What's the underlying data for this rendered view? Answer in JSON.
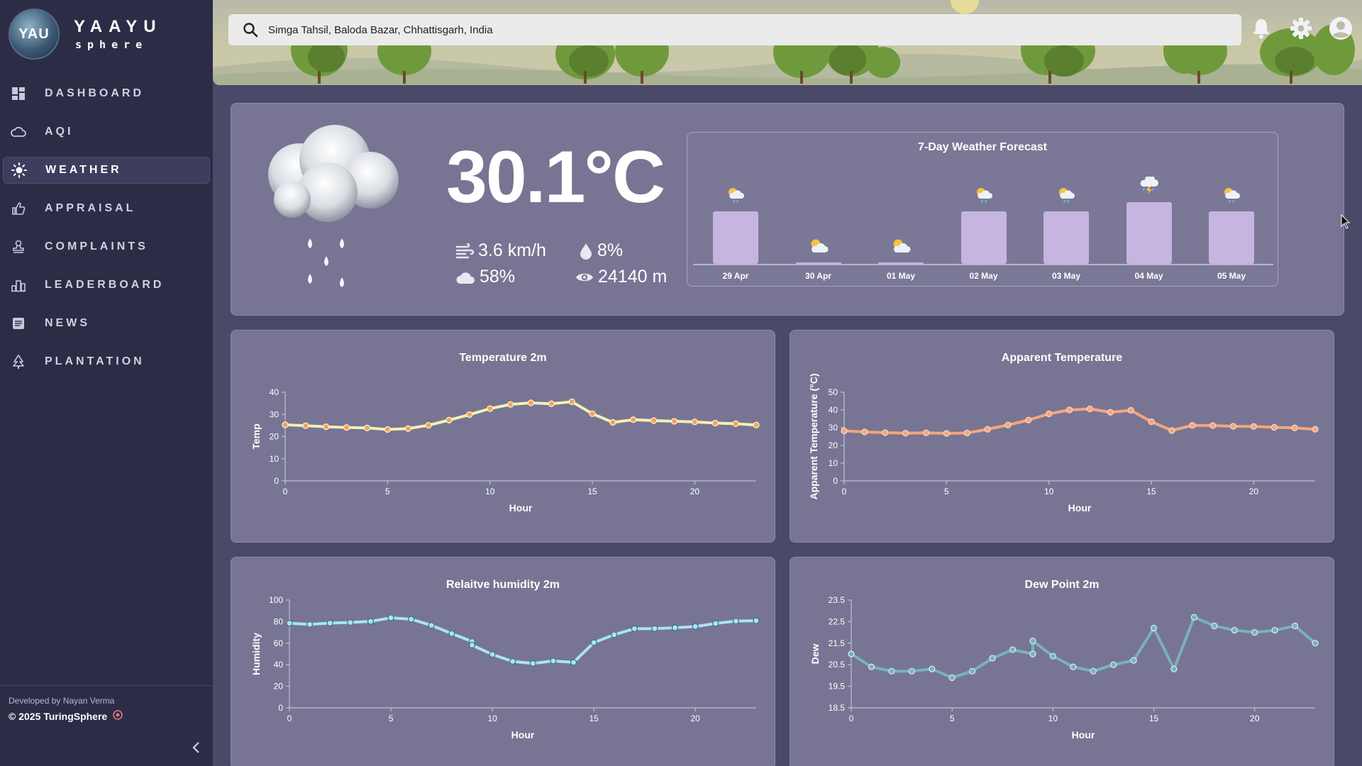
{
  "brand": {
    "logo_text": "YAU",
    "title": "YAAYU",
    "subtitle": "sphere"
  },
  "sidebar": {
    "items": [
      {
        "label": "DASHBOARD",
        "icon": "dashboard-icon",
        "active": false
      },
      {
        "label": "AQI",
        "icon": "cloud-icon",
        "active": false
      },
      {
        "label": "WEATHER",
        "icon": "sun-icon",
        "active": true
      },
      {
        "label": "APPRAISAL",
        "icon": "thumbs-up-icon",
        "active": false
      },
      {
        "label": "COMPLAINTS",
        "icon": "stamp-icon",
        "active": false
      },
      {
        "label": "LEADERBOARD",
        "icon": "leaderboard-icon",
        "active": false
      },
      {
        "label": "NEWS",
        "icon": "news-icon",
        "active": false
      },
      {
        "label": "PLANTATION",
        "icon": "tree-icon",
        "active": false
      }
    ],
    "footer": {
      "developed_by": "Developed by Nayan Verma",
      "copyright": "© 2025 TuringSphere"
    }
  },
  "header": {
    "search": {
      "value": "Simga Tahsil, Baloda Bazar, Chhattisgarh, India"
    },
    "icons": [
      "bell-icon",
      "gear-icon",
      "account-icon"
    ]
  },
  "current": {
    "temperature": "30.1°C",
    "wind": "3.6 km/h",
    "precipitation": "8%",
    "cloud": "58%",
    "visibility": "24140 m"
  },
  "forecast": {
    "title": "7-Day Weather Forecast",
    "days": [
      {
        "date": "29 Apr",
        "value": 1.0,
        "icon": "sun-cloud-rain-icon"
      },
      {
        "date": "30 Apr",
        "value": 0.03,
        "icon": "sun-cloud-icon"
      },
      {
        "date": "01 May",
        "value": 0.03,
        "icon": "sun-cloud-icon"
      },
      {
        "date": "02 May",
        "value": 1.0,
        "icon": "sun-cloud-rain-icon"
      },
      {
        "date": "03 May",
        "value": 1.0,
        "icon": "sun-cloud-rain-icon"
      },
      {
        "date": "04 May",
        "value": 1.18,
        "icon": "thunderstorm-icon"
      },
      {
        "date": "05 May",
        "value": 1.0,
        "icon": "sun-cloud-rain-icon"
      }
    ]
  },
  "colors": {
    "sidebar": "#2c2c47",
    "panel": "#777593",
    "temp_line": "#f3f0b4",
    "temp_dot": "#f4a261",
    "apparent_line": "#f4a57e",
    "humidity_line": "#a9e4f5",
    "dew_line": "#7bb0bd",
    "forecast_bar": "#c6b5e0"
  },
  "chart_data": [
    {
      "type": "line",
      "title": "Temperature 2m",
      "xlabel": "Hour",
      "ylabel": "Temp",
      "xlim": [
        0,
        23
      ],
      "ylim": [
        0,
        40
      ],
      "yticks": [
        0,
        10,
        20,
        30,
        40
      ],
      "xticks": [
        0,
        5,
        10,
        15,
        20
      ],
      "x": [
        0,
        1,
        2,
        3,
        4,
        5,
        6,
        7,
        8,
        9,
        10,
        11,
        12,
        13,
        14,
        15,
        16,
        17,
        18,
        19,
        20,
        21,
        22,
        23
      ],
      "series": [
        {
          "values": [
            25.3,
            24.9,
            24.4,
            24.1,
            23.9,
            23.2,
            23.6,
            25.1,
            27.4,
            29.9,
            32.6,
            34.5,
            35.2,
            34.8,
            35.7,
            30.3,
            26.4,
            27.6,
            27.2,
            26.9,
            26.6,
            26.1,
            25.8,
            25.2
          ]
        }
      ]
    },
    {
      "type": "line",
      "title": "Apparent Temperature",
      "xlabel": "Hour",
      "ylabel": "Apparent Temperature (°C)",
      "xlim": [
        0,
        23
      ],
      "ylim": [
        0,
        50
      ],
      "yticks": [
        0,
        10,
        20,
        30,
        40,
        50
      ],
      "xticks": [
        0,
        5,
        10,
        15,
        20
      ],
      "x": [
        0,
        1,
        2,
        3,
        4,
        5,
        6,
        7,
        8,
        9,
        10,
        11,
        12,
        13,
        14,
        15,
        16,
        17,
        18,
        19,
        20,
        21,
        22,
        23
      ],
      "series": [
        {
          "values": [
            28.2,
            27.6,
            27.2,
            26.9,
            27.1,
            26.8,
            27.0,
            29.1,
            31.5,
            34.3,
            37.8,
            40.0,
            40.6,
            38.7,
            39.8,
            33.4,
            28.4,
            31.3,
            31.2,
            30.8,
            30.7,
            30.2,
            29.9,
            29.1
          ]
        }
      ]
    },
    {
      "type": "line",
      "title": "Relaitve humidity 2m",
      "xlabel": "Hour",
      "ylabel": "Humidity",
      "xlim": [
        0,
        23
      ],
      "ylim": [
        0,
        100
      ],
      "yticks": [
        0,
        20,
        40,
        60,
        80,
        100
      ],
      "xticks": [
        0,
        5,
        10,
        15,
        20
      ],
      "x": [
        0,
        1,
        2,
        3,
        4,
        5,
        6,
        7,
        8,
        9,
        9,
        10,
        11,
        12,
        13,
        14,
        15,
        16,
        17,
        18,
        19,
        20,
        21,
        22,
        23
      ],
      "series": [
        {
          "values": [
            78.5,
            77.4,
            78.6,
            79.2,
            80.2,
            83.5,
            82.2,
            76.5,
            68.9,
            61.5,
            58.2,
            49.5,
            43.1,
            41.2,
            43.5,
            42.2,
            60.5,
            67.8,
            73.4,
            73.5,
            74.3,
            75.4,
            78.3,
            80.5,
            80.8
          ]
        }
      ]
    },
    {
      "type": "line",
      "title": "Dew Point 2m",
      "xlabel": "Hour",
      "ylabel": "Dew",
      "xlim": [
        0,
        23
      ],
      "ylim": [
        18.5,
        23.5
      ],
      "yticks": [
        18.5,
        19.5,
        20.5,
        21.5,
        22.5,
        23.5
      ],
      "xticks": [
        0,
        5,
        10,
        15,
        20
      ],
      "x": [
        0,
        1,
        2,
        3,
        4,
        5,
        6,
        7,
        8,
        9,
        9,
        10,
        11,
        12,
        13,
        14,
        15,
        16,
        17,
        18,
        19,
        20,
        21,
        22,
        23
      ],
      "series": [
        {
          "values": [
            21.0,
            20.4,
            20.2,
            20.2,
            20.3,
            19.9,
            20.2,
            20.8,
            21.2,
            21.0,
            21.6,
            20.9,
            20.4,
            20.2,
            20.5,
            20.7,
            22.2,
            20.3,
            22.7,
            22.3,
            22.1,
            22.0,
            22.1,
            22.3,
            21.5
          ]
        }
      ]
    }
  ]
}
